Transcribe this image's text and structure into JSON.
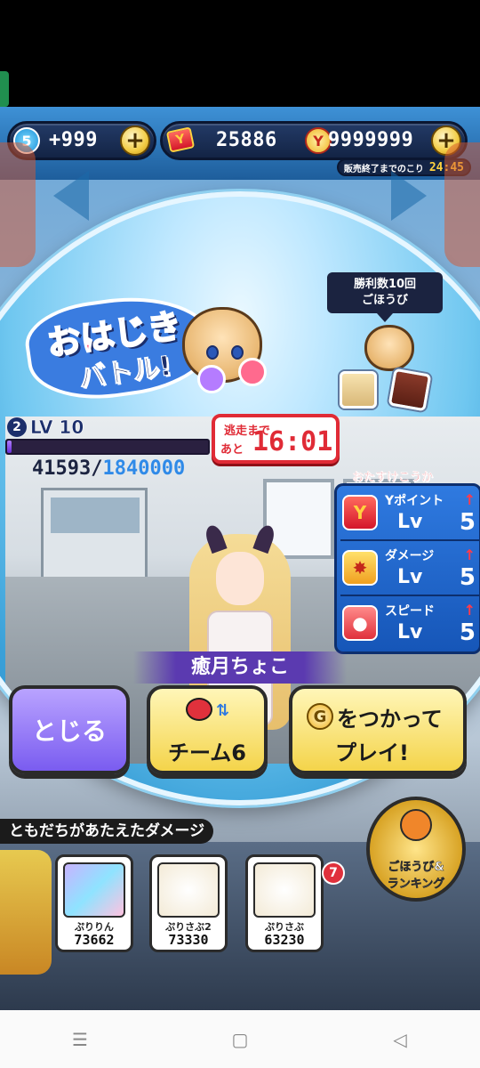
{
  "currency": {
    "g_level": "5",
    "g_amount": "+999",
    "y_ticket_amount": "25886",
    "y_money_amount": "9999999",
    "sale_label": "販売終了までのこり",
    "sale_time": "24:45"
  },
  "event": {
    "title_line1": "おはじき",
    "title_line2": "バトル!",
    "reward_label_line1": "勝利数10回",
    "reward_label_line2": "ごほうび"
  },
  "boss": {
    "lv_badge": "2",
    "lv_text": "LV 10",
    "hp_current": "41593",
    "hp_separator": "/",
    "hp_max": "1840000",
    "hp_fraction": 0.0226,
    "escape_line1": "逃走まで",
    "escape_line2": "あと",
    "escape_time": "16:01",
    "name": "癒月ちょこ"
  },
  "assist": {
    "title": "おたすけこうか",
    "items": [
      {
        "name": "Yポイント",
        "lv": "Lv",
        "level": "5",
        "icon": "y-point-icon"
      },
      {
        "name": "ダメージ",
        "lv": "Lv",
        "level": "5",
        "icon": "damage-icon"
      },
      {
        "name": "スピード",
        "lv": "Lv",
        "level": "5",
        "icon": "speed-icon"
      }
    ],
    "up_glyph": "↑"
  },
  "buttons": {
    "close": "とじる",
    "team": "チーム6",
    "play_line1": "をつかって",
    "play_line2": "プレイ!",
    "play_icon": "G"
  },
  "friends": {
    "label": "ともだちがあたえたダメージ",
    "cards": [
      {
        "name": "ぷりりん",
        "score": "73662"
      },
      {
        "name": "ぷりさぶ2",
        "score": "73330"
      },
      {
        "name": "ぷりさぶ",
        "score": "63230"
      }
    ],
    "notification_count": "7"
  },
  "ranking": {
    "label_line1": "ごほうび&",
    "label_line2": "ランキング"
  },
  "colors": {
    "accent_red": "#e02b36",
    "hp_purple": "#6a2fd6",
    "panel_blue": "#1656b8",
    "button_yellow": "#f4d44a",
    "button_purple": "#7a5cf0"
  }
}
